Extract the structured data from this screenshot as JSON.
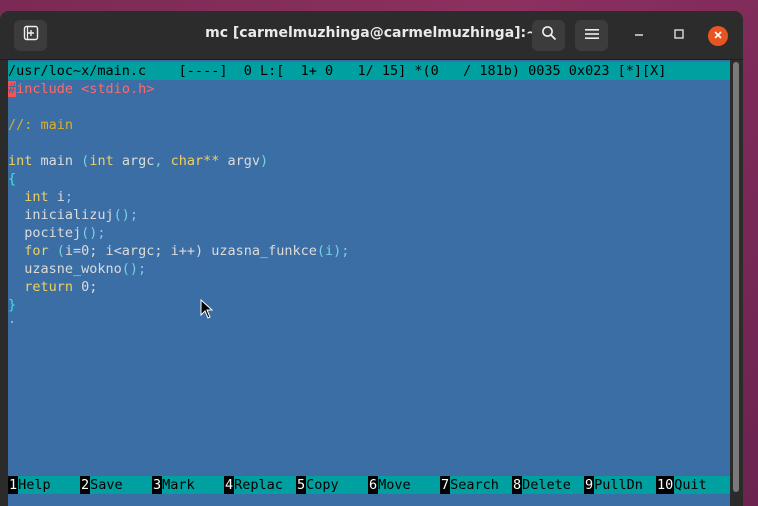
{
  "window": {
    "title": "mc [carmelmuzhinga@carmelmuzhinga]:~"
  },
  "status_line": "/usr/loc~x/main.c    [----]  0 L:[  1+ 0   1/ 15] *(0   / 181b) 0035 0x023 [*][X]",
  "code": {
    "line1_first": "#",
    "line1_kw": "include",
    "line1_hdr": " <stdio.h>",
    "comment": "//: main",
    "main_int": "int",
    "main_name": " main ",
    "main_paren": "(",
    "main_int2": "int",
    "main_argc": " argc",
    "main_comma": ", ",
    "main_char": "char**",
    "main_argv": " argv",
    "main_close": ")",
    "open_brace": "{",
    "decl_int": "  int",
    "decl_i": " i",
    "semicolon": ";",
    "call1": "  inicializuj",
    "call2": "  pocitej",
    "parens_semi": "();",
    "for_kw": "  for",
    "for_rest_1": " (",
    "for_init": "i=0",
    "for_rest_2": "; i<argc; i++) uzasna_funkce",
    "for_call_args": "(i);",
    "call3": "  uzasne_wokno",
    "return_kw": "  return",
    "return_val": " 0;",
    "close_brace": "}",
    "tail_dot": "."
  },
  "fkeys": [
    {
      "num": "1",
      "label": "Help"
    },
    {
      "num": "2",
      "label": "Save"
    },
    {
      "num": "3",
      "label": "Mark"
    },
    {
      "num": "4",
      "label": "Replac"
    },
    {
      "num": "5",
      "label": "Copy"
    },
    {
      "num": "6",
      "label": "Move"
    },
    {
      "num": "7",
      "label": "Search"
    },
    {
      "num": "8",
      "label": "Delete"
    },
    {
      "num": "9",
      "label": "PullDn"
    },
    {
      "num": "10",
      "label": "Quit"
    }
  ],
  "icons": {
    "new_tab": "new-tab-icon",
    "search": "search-icon",
    "menu": "hamburger-menu-icon",
    "minimize": "minimize-icon",
    "maximize": "maximize-icon",
    "close": "close-icon"
  }
}
